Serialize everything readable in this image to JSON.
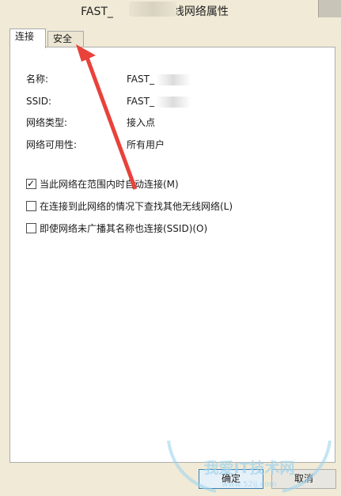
{
  "window": {
    "title_prefix": "FAST_",
    "title_suffix": "无线网络属性"
  },
  "tabs": [
    {
      "label": "连接",
      "active": true
    },
    {
      "label": "安全",
      "active": false
    }
  ],
  "info": [
    {
      "label": "名称:",
      "value": "FAST_"
    },
    {
      "label": "SSID:",
      "value": "FAST_"
    },
    {
      "label": "网络类型:",
      "value": "接入点"
    },
    {
      "label": "网络可用性:",
      "value": "所有用户"
    }
  ],
  "options": [
    {
      "label": "当此网络在范围内时自动连接(M)",
      "checked": true
    },
    {
      "label": "在连接到此网络的情况下查找其他无线网络(L)",
      "checked": false
    },
    {
      "label": "即使网络未广播其名称也连接(SSID)(O)",
      "checked": false
    }
  ],
  "buttons": {
    "ok": "确定",
    "cancel": "取消"
  },
  "watermark": {
    "text": "我爱IT技术网",
    "url": "www.52ij.com"
  },
  "colors": {
    "annotation_arrow": "#e8423a",
    "window_frame": "#f0ead6"
  }
}
